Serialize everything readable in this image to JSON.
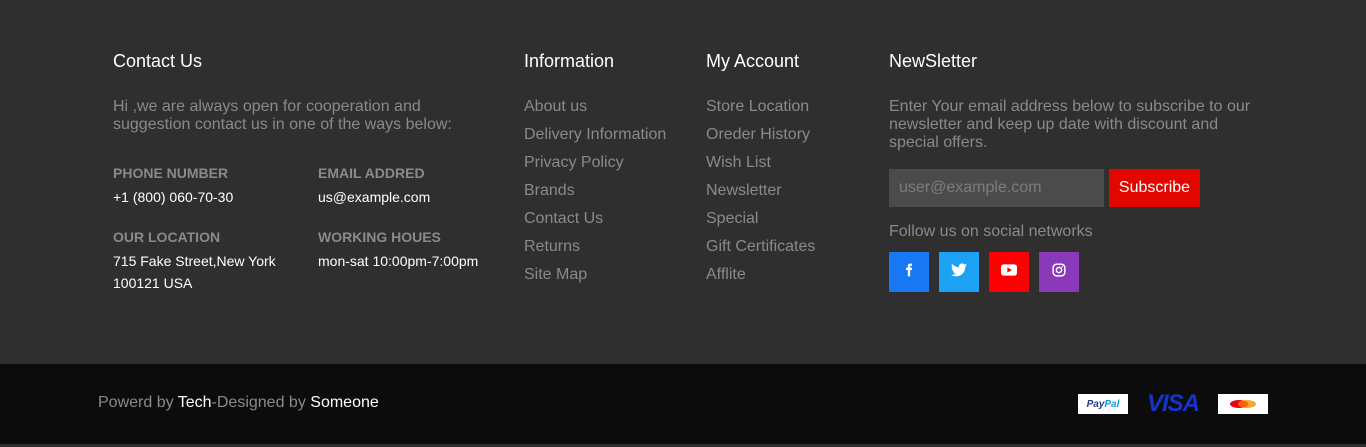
{
  "contact": {
    "title": "Contact Us",
    "intro": "Hi ,we are always open for cooperation and suggestion contact us in one of the ways below:",
    "phone_label": "PHONE NUMBER",
    "phone_value": "+1 (800) 060-70-30",
    "email_label": "EMAIL ADDRED",
    "email_value": "us@example.com",
    "location_label": "OUR LOCATION",
    "location_line1": "715 Fake Street,New York",
    "location_line2": "100121 USA",
    "hours_label": "WORKING HOUES",
    "hours_value": "mon-sat 10:00pm-7:00pm"
  },
  "information": {
    "title": "Information",
    "links": [
      "About us",
      "Delivery Information",
      "Privacy Policy",
      "Brands",
      "Contact Us",
      "Returns",
      "Site Map"
    ]
  },
  "account": {
    "title": "My Account",
    "links": [
      "Store Location",
      "Oreder History",
      "Wish List",
      "Newsletter",
      "Special",
      "Gift Certificates",
      "Afflite"
    ]
  },
  "newsletter": {
    "title": "NewSletter",
    "description": "Enter Your email address below to subscribe to our newsletter and keep up date with discount and special offers.",
    "input_placeholder": "user@example.com",
    "subscribe_label": "Subscribe",
    "follow_text": "Follow us on social networks",
    "social": [
      {
        "icon": "facebook-icon",
        "color": "#1877f2"
      },
      {
        "icon": "twitter-icon",
        "color": "#1da1f2"
      },
      {
        "icon": "youtube-icon",
        "color": "#ff0000"
      },
      {
        "icon": "instagram-icon",
        "color": "#8a3ab9"
      }
    ]
  },
  "bottom": {
    "powered_prefix": "Powerd by ",
    "powered_name": "Tech",
    "designed_prefix": "-Designed by ",
    "designed_name": "Someone",
    "payment_icons": [
      "paypal-icon",
      "visa-icon",
      "mastercard-icon"
    ]
  },
  "colors": {
    "top_bg": "#2f2f2f",
    "bottom_bg": "#0c0c0c",
    "accent": "#e10600"
  }
}
